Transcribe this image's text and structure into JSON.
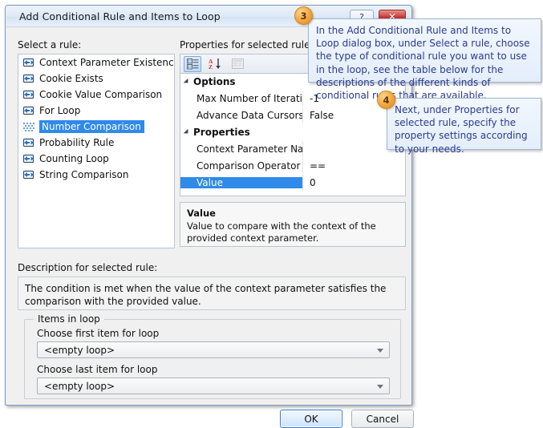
{
  "window": {
    "title": "Add Conditional Rule and Items to Loop",
    "help_button": "?",
    "close_button": "✕"
  },
  "labels": {
    "select_rule": "Select a rule:",
    "properties_for_selected": "Properties for selected rule:",
    "description_for_selected": "Description for selected rule:"
  },
  "rule_list": {
    "selected": "Number Comparison",
    "items": [
      {
        "label": "Context Parameter Existence",
        "icon": "rule-icon",
        "selected": false
      },
      {
        "label": "Cookie Exists",
        "icon": "rule-icon",
        "selected": false
      },
      {
        "label": "Cookie Value Comparison",
        "icon": "rule-icon",
        "selected": false
      },
      {
        "label": "For Loop",
        "icon": "rule-icon",
        "selected": false
      },
      {
        "label": "Number Comparison",
        "icon": "rule-icon-selected",
        "selected": true
      },
      {
        "label": "Probability Rule",
        "icon": "rule-icon",
        "selected": false
      },
      {
        "label": "Counting Loop",
        "icon": "rule-icon",
        "selected": false
      },
      {
        "label": "String Comparison",
        "icon": "rule-icon",
        "selected": false
      }
    ]
  },
  "property_grid": {
    "toolbar": [
      {
        "name": "categorized-view-button",
        "state": "active"
      },
      {
        "name": "alphabetical-sort-button",
        "state": "normal"
      },
      {
        "name": "property-pages-button",
        "state": "disabled"
      }
    ],
    "rows": [
      {
        "type": "category",
        "name": "Options",
        "value": ""
      },
      {
        "type": "property",
        "name": "Max Number of Iterations",
        "value": "-1",
        "selected": false
      },
      {
        "type": "property",
        "name": "Advance Data Cursors",
        "value": "False",
        "selected": false
      },
      {
        "type": "category",
        "name": "Properties",
        "value": ""
      },
      {
        "type": "property",
        "name": "Context Parameter Name",
        "value": "",
        "selected": false
      },
      {
        "type": "property",
        "name": "Comparison Operator",
        "value": "==",
        "selected": false
      },
      {
        "type": "property",
        "name": "Value",
        "value": "0",
        "selected": true
      }
    ],
    "help": {
      "title": "Value",
      "text": "Value to compare with the context of the provided context parameter."
    }
  },
  "description": {
    "text": "The condition is met when the value of the context parameter satisfies the comparison with the provided value."
  },
  "items_in_loop": {
    "group_title": "Items in loop",
    "first_label": "Choose first item for loop",
    "first_value": "<empty loop>",
    "last_label": "Choose last item for loop",
    "last_value": "<empty loop>"
  },
  "buttons": {
    "ok": "OK",
    "cancel": "Cancel"
  },
  "callouts": [
    {
      "number": "3",
      "text": "In the Add Conditional Rule and Items to Loop dialog box, under Select a rule, choose the type of conditional rule you want to use in the loop, see the table below for the descriptions of the different kinds of conditional rules that are available."
    },
    {
      "number": "4",
      "text": "Next, under Properties for selected rule, specify the property settings according to your needs."
    }
  ],
  "colors": {
    "selection_blue": "#2f8ae8",
    "callout_text": "#2b3b8f",
    "badge_orange": "#f0a13a",
    "close_red": "#c9403a",
    "titlebar": "#dfeaf7"
  }
}
